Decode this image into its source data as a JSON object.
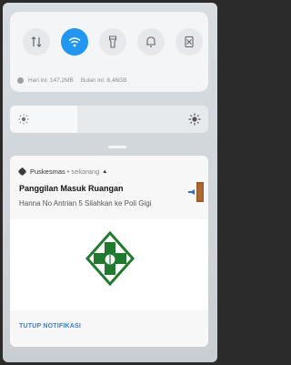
{
  "quick_settings": {
    "tiles": [
      {
        "name": "data-sync-icon",
        "active": false
      },
      {
        "name": "wifi-icon",
        "active": true
      },
      {
        "name": "flashlight-icon",
        "active": false
      },
      {
        "name": "bell-icon",
        "active": false
      },
      {
        "name": "no-signal-icon",
        "active": false
      }
    ],
    "usage_today": "Hari ini: 147,2MB",
    "usage_month": "Bulan ini: 8,46GB"
  },
  "brightness": {
    "level": 0.34
  },
  "notification": {
    "app_name": "Puskesmas",
    "separator": "•",
    "time": "sekarang",
    "expand_icon": "chevron-up-icon",
    "title": "Panggilan Masuk Ruangan",
    "text": "Hanna No Antrian 5  Silahkan ke Poli Gigi",
    "large_icon": "door-icon",
    "image": "puskesmas-logo-icon",
    "action_label": "TUTUP NOTIFIKASI"
  },
  "colors": {
    "accent": "#2196f3",
    "action": "#3b7dd8",
    "logo_green": "#1f7a2e"
  }
}
